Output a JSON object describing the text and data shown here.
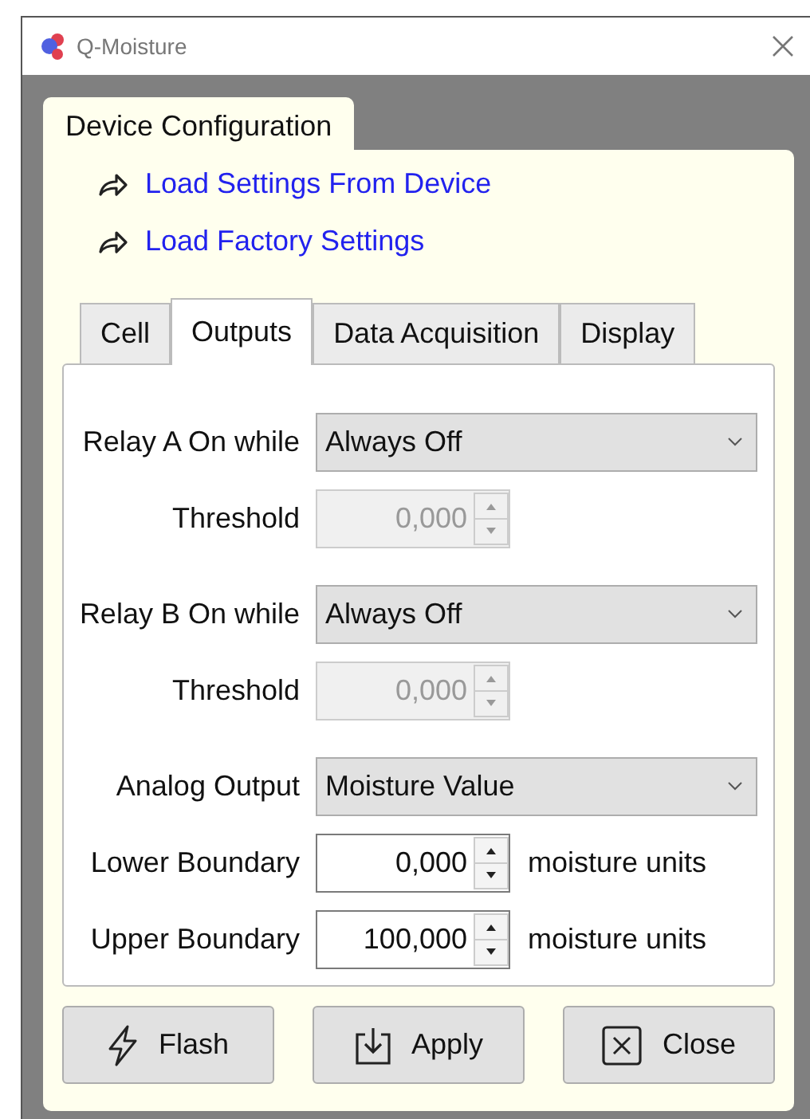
{
  "window": {
    "title": "Q-Moisture"
  },
  "group": {
    "title": "Device Configuration"
  },
  "links": [
    {
      "label": "Load Settings From Device"
    },
    {
      "label": "Load Factory Settings"
    }
  ],
  "tabs": [
    {
      "label": "Cell",
      "selected": false
    },
    {
      "label": "Outputs",
      "selected": true
    },
    {
      "label": "Data Acquisition",
      "selected": false
    },
    {
      "label": "Display",
      "selected": false
    }
  ],
  "fields": [
    {
      "kind": "combo",
      "label": "Relay A On while",
      "value": "Always Off"
    },
    {
      "kind": "spin",
      "label": "Threshold",
      "value": "0,000",
      "disabled": true
    },
    {
      "kind": "gap"
    },
    {
      "kind": "combo",
      "label": "Relay B On while",
      "value": "Always Off"
    },
    {
      "kind": "spin",
      "label": "Threshold",
      "value": "0,000",
      "disabled": true
    },
    {
      "kind": "gap"
    },
    {
      "kind": "combo",
      "label": "Analog Output",
      "value": "Moisture Value"
    },
    {
      "kind": "spin",
      "label": "Lower Boundary",
      "value": "0,000",
      "disabled": false,
      "units": "moisture units"
    },
    {
      "kind": "spin",
      "label": "Upper Boundary",
      "value": "100,000",
      "disabled": false,
      "units": "moisture units"
    }
  ],
  "buttons": [
    {
      "kind": "flash",
      "label": "Flash"
    },
    {
      "kind": "apply",
      "label": "Apply"
    },
    {
      "kind": "close",
      "label": "Close"
    }
  ]
}
